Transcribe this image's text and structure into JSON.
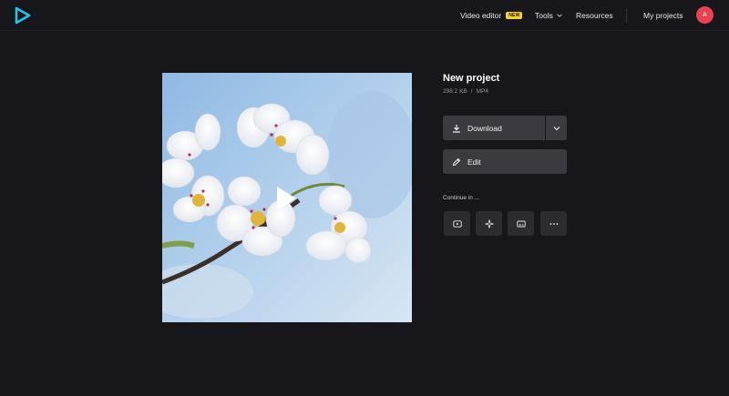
{
  "header": {
    "nav": {
      "video_editor": "Video editor",
      "new_badge": "NEW",
      "tools": "Tools",
      "resources": "Resources",
      "my_projects": "My projects"
    },
    "avatar_initial": "A"
  },
  "project": {
    "title": "New project",
    "size": "298.2 KB",
    "separator": "/",
    "format": "MP4"
  },
  "actions": {
    "download_label": "Download",
    "edit_label": "Edit",
    "continue_label": "Continue in ..."
  },
  "icons": {
    "logo": "play-logo-icon",
    "download": "download-icon",
    "edit": "pencil-icon",
    "caret": "chevron-down-icon",
    "tiles": [
      "youtube-icon",
      "sparkle-icon",
      "subtitles-icon",
      "more-icon"
    ]
  },
  "colors": {
    "background": "#17171b",
    "button": "#3a3a40",
    "tile": "#2b2b30",
    "badge": "#f6d12c",
    "avatar": "#e8434f",
    "logo": "#22c4e8"
  }
}
